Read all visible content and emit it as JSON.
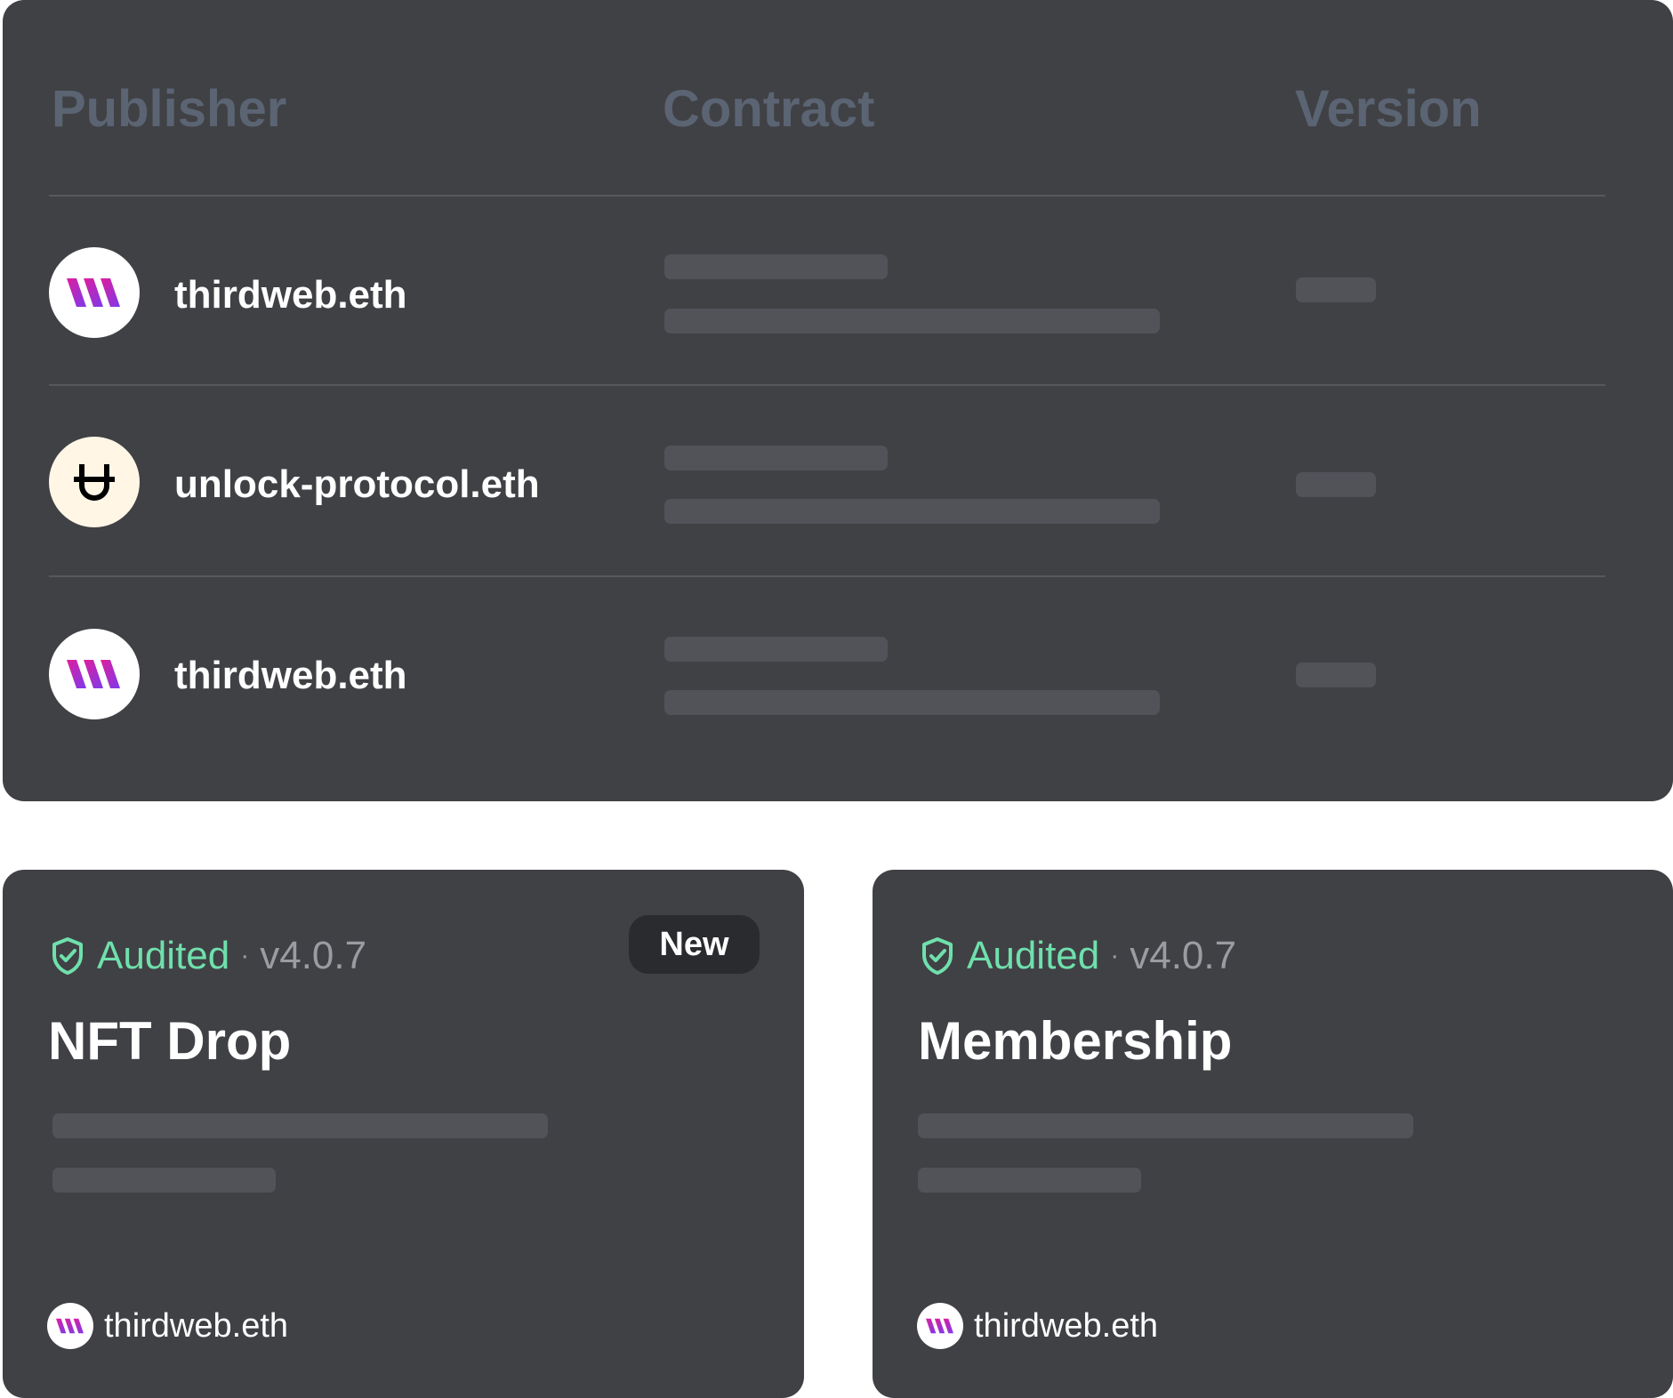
{
  "table": {
    "headers": {
      "publisher": "Publisher",
      "contract": "Contract",
      "version": "Version"
    },
    "rows": [
      {
        "publisher": "thirdweb.eth",
        "avatar_icon": "thirdweb-logo-icon"
      },
      {
        "publisher": "unlock-protocol.eth",
        "avatar_icon": "unlock-logo-icon"
      },
      {
        "publisher": "thirdweb.eth",
        "avatar_icon": "thirdweb-logo-icon"
      }
    ]
  },
  "cards": [
    {
      "status": "Audited",
      "separator": "·",
      "version": "v4.0.7",
      "title": "NFT Drop",
      "badge": "New",
      "publisher": "thirdweb.eth",
      "status_icon": "shield-check-icon"
    },
    {
      "status": "Audited",
      "separator": "·",
      "version": "v4.0.7",
      "title": "Membership",
      "publisher": "thirdweb.eth",
      "status_icon": "shield-check-icon"
    }
  ],
  "colors": {
    "panel": "#404145",
    "header_text": "#5b6473",
    "skeleton": "#525359",
    "audited": "#6fe0ac",
    "muted": "#9a9ca1",
    "thirdweb_gradient_start": "#c026d3",
    "thirdweb_gradient_end": "#7c3aed"
  }
}
